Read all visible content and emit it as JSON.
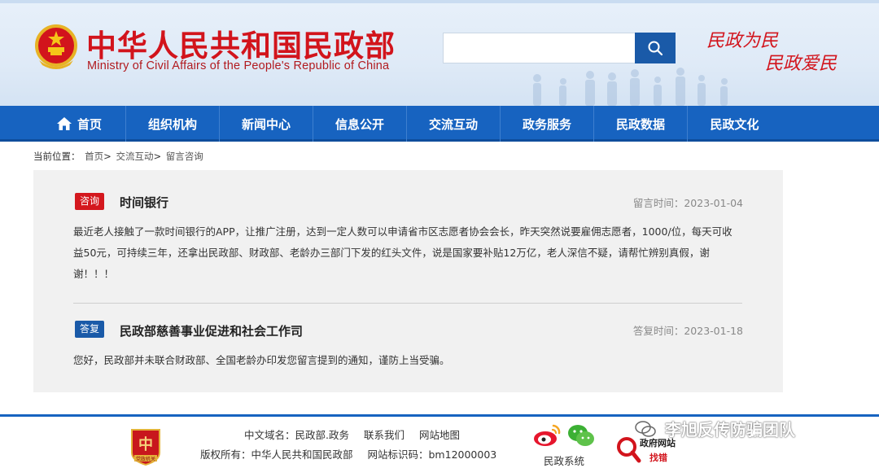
{
  "header": {
    "title_cn": "中华人民共和国民政部",
    "title_en": "Ministry of Civil Affairs of the People's Republic of China",
    "search": {
      "placeholder": "",
      "value": ""
    },
    "slogan_1": "民政为民",
    "slogan_2": "民政爱民"
  },
  "nav": {
    "items": [
      {
        "label": "首页",
        "icon": "home-icon"
      },
      {
        "label": "组织机构"
      },
      {
        "label": "新闻中心"
      },
      {
        "label": "信息公开"
      },
      {
        "label": "交流互动"
      },
      {
        "label": "政务服务"
      },
      {
        "label": "民政数据"
      },
      {
        "label": "民政文化"
      }
    ]
  },
  "breadcrumb": {
    "prefix": "当前位置：",
    "items": [
      "首页",
      "交流互动",
      "留言咨询"
    ],
    "separator": ">"
  },
  "message": {
    "tag": "咨询",
    "title": "时间银行",
    "time": "留言时间：2023-01-04",
    "body": "最近老人接触了一款时间银行的APP，让推广注册，达到一定人数可以申请省市区志愿者协会会长，昨天突然说要雇佣志愿者，1000/位，每天可收益50元，可持续三年，还拿出民政部、财政部、老龄办三部门下发的红头文件，说是国家要补贴12万亿，老人深信不疑，请帮忙辨别真假，谢谢！！！"
  },
  "reply": {
    "tag": "答复",
    "title": "民政部慈善事业促进和社会工作司",
    "time": "答复时间：2023-01-18",
    "body": "您好，民政部并未联合财政部、全国老龄办印发您留言提到的通知，谨防上当受骗。"
  },
  "footer": {
    "domain": "中文域名：民政部.政务",
    "contact": "联系我们",
    "sitemap": "网站地图",
    "copyright": "版权所有：中华人民共和国民政部",
    "site_id": "网站标识码：bm12000003",
    "system": "民政系统",
    "gov_find_1": "政府网站",
    "gov_find_2": "找错",
    "badge_text": "党政机关",
    "watermark": "李旭反传防骗团队"
  },
  "colors": {
    "brand_red": "#d2141c",
    "nav_blue": "#1763c0",
    "tag_reply_blue": "#1a5aa8",
    "panel_bg": "#f1f1f1"
  }
}
